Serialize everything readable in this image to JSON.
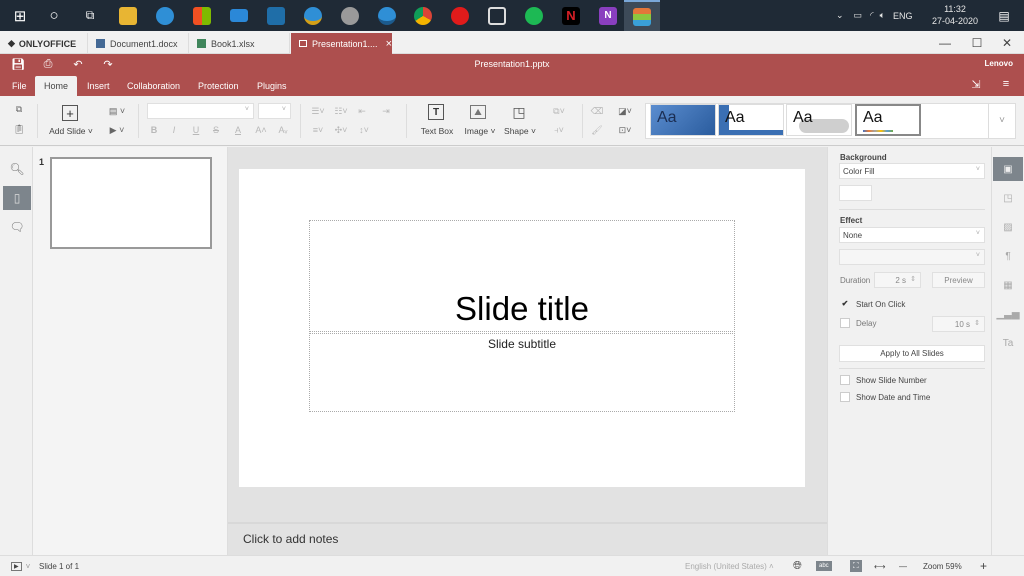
{
  "taskbar": {
    "apps": [
      {
        "name": "start",
        "glyph": "⊞",
        "color": "#ffffff"
      },
      {
        "name": "cortana",
        "glyph": "○",
        "color": "#ffffff"
      },
      {
        "name": "task-view",
        "glyph": "⧉",
        "color": "#ffffff"
      },
      {
        "name": "file-explorer",
        "color": "#e8b533"
      },
      {
        "name": "edge",
        "color": "#2f8fd6"
      },
      {
        "name": "microsoft-store",
        "color": "#f2f2f2"
      },
      {
        "name": "mail",
        "color": "#2b88d8"
      },
      {
        "name": "whatsapp",
        "color": "#1f6ea8"
      },
      {
        "name": "edge-canary",
        "color": "#2f8fd6"
      },
      {
        "name": "app-grey",
        "color": "#9a9a9a"
      },
      {
        "name": "edge-beta",
        "color": "#2f8fd6"
      },
      {
        "name": "chrome",
        "color": "#e0a91b"
      },
      {
        "name": "youtube-music",
        "color": "#e01b1b"
      },
      {
        "name": "photos",
        "color": "#dddddd"
      },
      {
        "name": "spotify",
        "color": "#1db954"
      },
      {
        "name": "netflix",
        "color": "#d81f26"
      },
      {
        "name": "onenote",
        "color": "#8a3fbf"
      },
      {
        "name": "onlyoffice",
        "color": "#e3763a"
      }
    ],
    "tray": {
      "language": "ENG",
      "time": "11:32",
      "date": "27-04-2020"
    }
  },
  "tabs": {
    "brand": "ONLYOFFICE",
    "items": [
      {
        "label": "Document1.docx",
        "type": "doc",
        "color": "#446995"
      },
      {
        "label": "Book1.xlsx",
        "type": "sheet",
        "color": "#40865c"
      },
      {
        "label": "Presentation1....",
        "type": "slide",
        "active": true
      }
    ],
    "close": "×"
  },
  "window": {
    "minimize": "—",
    "maximize": "☐",
    "close": "✕"
  },
  "header": {
    "title": "Presentation1.pptx",
    "user": "Lenovo",
    "accent": "#ad4f4e",
    "menu": [
      "File",
      "Home",
      "Insert",
      "Collaboration",
      "Protection",
      "Plugins"
    ],
    "active_menu": "Home"
  },
  "toolbar": {
    "add_slide": "Add Slide",
    "text_box": "Text Box",
    "image": "Image",
    "shape": "Shape",
    "font_name": "",
    "font_size": "",
    "format": {
      "bold": "B",
      "italic": "I",
      "underline": "U",
      "strike": "S",
      "color": "A",
      "grow": "A˄",
      "shrink": "Aᵥ"
    },
    "themes": [
      "Aa",
      "Aa",
      "Aa",
      "Aa"
    ]
  },
  "thumbnails": [
    {
      "number": "1"
    }
  ],
  "slide": {
    "title": "Slide title",
    "subtitle": "Slide subtitle"
  },
  "notes": {
    "placeholder": "Click to add notes"
  },
  "panel": {
    "background_label": "Background",
    "background_value": "Color Fill",
    "effect_label": "Effect",
    "effect_value": "None",
    "effect_type_value": "",
    "duration_label": "Duration",
    "duration_value": "2 s",
    "preview_label": "Preview",
    "start_on_click_label": "Start On Click",
    "start_on_click_checked": true,
    "delay_label": "Delay",
    "delay_checked": false,
    "delay_value": "10 s",
    "apply_all_label": "Apply to All Slides",
    "show_slide_number_label": "Show Slide Number",
    "show_slide_number_checked": false,
    "show_date_time_label": "Show Date and Time",
    "show_date_time_checked": false
  },
  "statusbar": {
    "slide_counter": "Slide 1 of 1",
    "language": "English (United States)",
    "zoom": "Zoom 59%",
    "zoom_out": "—",
    "zoom_in": "+"
  }
}
